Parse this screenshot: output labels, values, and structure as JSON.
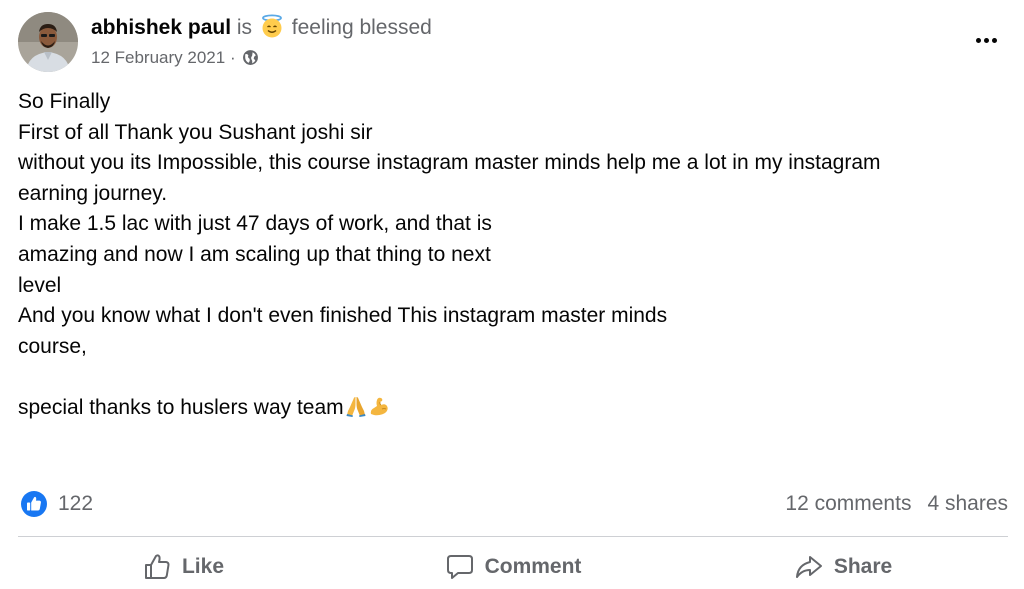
{
  "post": {
    "author": "abhishek paul",
    "is_word": "is",
    "feeling": "feeling blessed",
    "feeling_icon": "smiling-face-with-halo-icon",
    "date": "12 February 2021",
    "date_separator": "·",
    "privacy_icon": "globe-icon",
    "more_icon": "more-options-icon",
    "body_lines": [
      "So Finally",
      "First of all Thank you Sushant joshi sir",
      "without you its Impossible, this course instagram master minds help me a lot in my instagram",
      "earning journey.",
      "I make 1.5 lac with just 47 days of work, and that is",
      "amazing and now I am scaling up that thing to next",
      "level",
      "And you know what I don't even finished This instagram master minds",
      "course,",
      "",
      "special thanks to huslers way team"
    ],
    "trailing_emojis": [
      "folded-hands-icon",
      "flexed-biceps-icon"
    ]
  },
  "stats": {
    "reaction_icon": "like-reaction-icon",
    "likes": "122",
    "comments": "12 comments",
    "shares": "4 shares"
  },
  "actions": {
    "like_label": "Like",
    "comment_label": "Comment",
    "share_label": "Share"
  },
  "colors": {
    "primary_text": "#050505",
    "secondary_text": "#65676b",
    "like_blue": "#1877f2",
    "divider": "#ced0d4"
  }
}
